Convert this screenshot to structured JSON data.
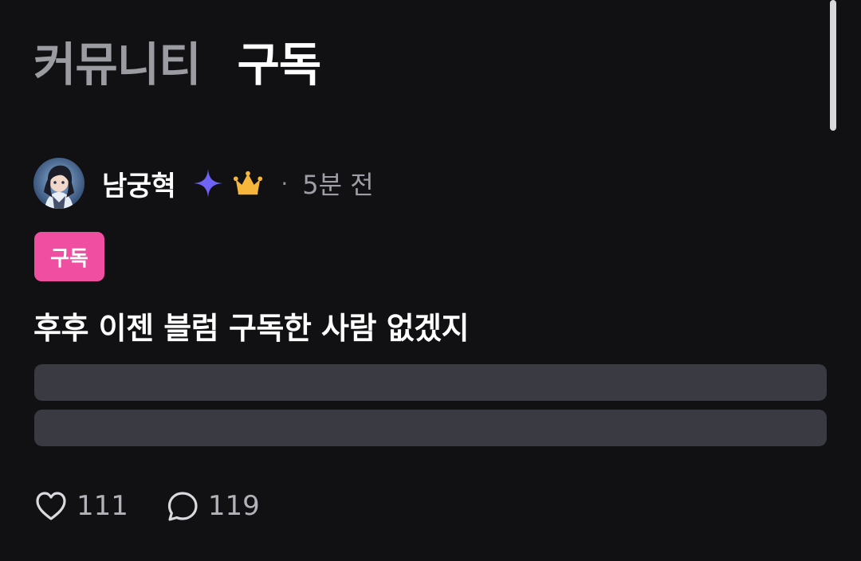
{
  "tabs": [
    {
      "label": "커뮤니티",
      "active": false
    },
    {
      "label": "구독",
      "active": true
    }
  ],
  "post": {
    "author": {
      "name": "남궁혁",
      "avatar_icon": "anime-character-avatar",
      "badges": [
        "sparkle-badge-icon",
        "crown-badge-icon"
      ]
    },
    "separator": "·",
    "time": "5분 전",
    "category": "구독",
    "title": "후후 이젠 블럼 구독한 사람 없겠지",
    "likes": "111",
    "comments": "119"
  },
  "colors": {
    "background": "#111114",
    "tag_pink": "#f04ea0",
    "sparkle_purple": "#6f63f5",
    "crown_gold": "#f5b63b",
    "placeholder": "#3a3a43"
  }
}
